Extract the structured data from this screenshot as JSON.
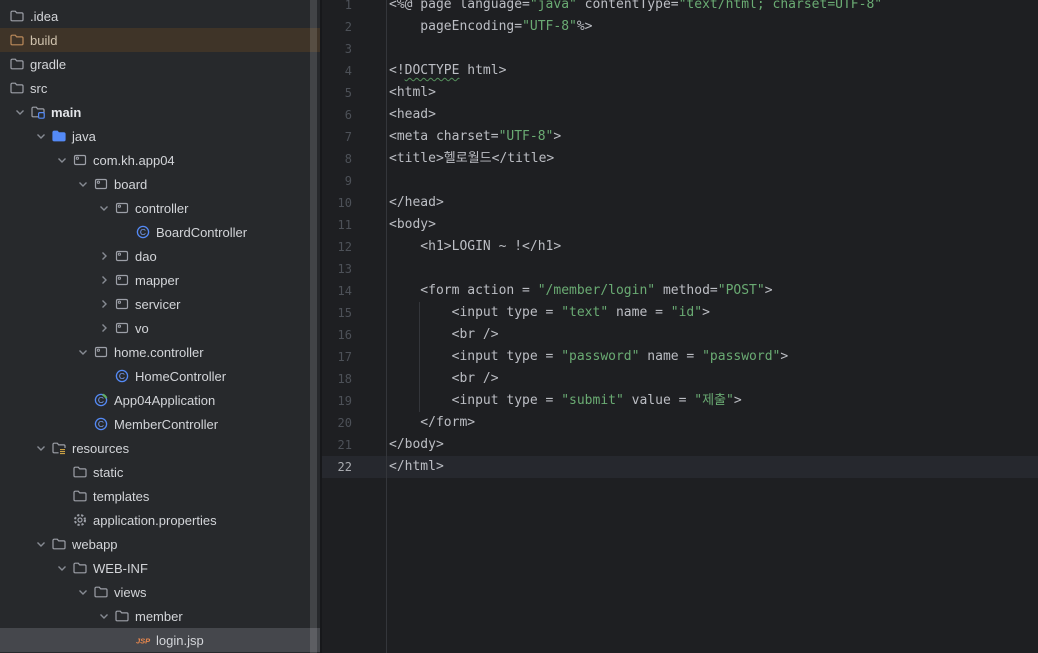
{
  "colors": {
    "editor_bg": "#1e1f22",
    "panel_bg": "#27292c",
    "code_text": "#bcbec4",
    "string_green": "#6aab73",
    "line_number_gray": "#4d5158",
    "active_line_bg": "#26282e",
    "selected_row_bg": "#45474c",
    "excluded_row_bg": "#3f3428",
    "excluded_orange": "#bb8a5a",
    "accent_blue": "#548af7",
    "run_green": "#5fad65",
    "jsp_orange": "#e8874c",
    "resources_yellow": "#caa144",
    "squiggle_green": "#56915d"
  },
  "project_tree": {
    "items": [
      {
        "label": ".idea",
        "level": 0,
        "icon": "folder",
        "chevron": null
      },
      {
        "label": "build",
        "level": 0,
        "icon": "folder-excluded",
        "chevron": null,
        "highlight": "excluded"
      },
      {
        "label": "gradle",
        "level": 0,
        "icon": "folder",
        "chevron": null
      },
      {
        "label": "src",
        "level": 0,
        "icon": "folder",
        "chevron": null
      },
      {
        "label": "main",
        "level": 1,
        "icon": "folder-main",
        "chevron": "expanded",
        "bold": true
      },
      {
        "label": "java",
        "level": 2,
        "icon": "folder-source",
        "chevron": "expanded"
      },
      {
        "label": "com.kh.app04",
        "level": 3,
        "icon": "package",
        "chevron": "expanded"
      },
      {
        "label": "board",
        "level": 4,
        "icon": "package",
        "chevron": "expanded"
      },
      {
        "label": "controller",
        "level": 5,
        "icon": "package",
        "chevron": "expanded"
      },
      {
        "label": "BoardController",
        "level": 6,
        "icon": "class",
        "chevron": null
      },
      {
        "label": "dao",
        "level": 5,
        "icon": "package",
        "chevron": "collapsed"
      },
      {
        "label": "mapper",
        "level": 5,
        "icon": "package",
        "chevron": "collapsed"
      },
      {
        "label": "servicer",
        "level": 5,
        "icon": "package",
        "chevron": "collapsed"
      },
      {
        "label": "vo",
        "level": 5,
        "icon": "package",
        "chevron": "collapsed"
      },
      {
        "label": "home.controller",
        "level": 4,
        "icon": "package",
        "chevron": "expanded"
      },
      {
        "label": "HomeController",
        "level": 5,
        "icon": "class",
        "chevron": null
      },
      {
        "label": "App04Application",
        "level": 4,
        "icon": "class-run",
        "chevron": null
      },
      {
        "label": "MemberController",
        "level": 4,
        "icon": "class",
        "chevron": null
      },
      {
        "label": "resources",
        "level": 2,
        "icon": "folder-resources",
        "chevron": "expanded"
      },
      {
        "label": "static",
        "level": 3,
        "icon": "folder",
        "chevron": null
      },
      {
        "label": "templates",
        "level": 3,
        "icon": "folder",
        "chevron": null
      },
      {
        "label": "application.properties",
        "level": 3,
        "icon": "gear",
        "chevron": null
      },
      {
        "label": "webapp",
        "level": 2,
        "icon": "folder",
        "chevron": "expanded"
      },
      {
        "label": "WEB-INF",
        "level": 3,
        "icon": "folder",
        "chevron": "expanded"
      },
      {
        "label": "views",
        "level": 4,
        "icon": "folder",
        "chevron": "expanded"
      },
      {
        "label": "member",
        "level": 5,
        "icon": "folder",
        "chevron": "expanded"
      },
      {
        "label": "login.jsp",
        "level": 6,
        "icon": "jsp",
        "chevron": null,
        "highlight": "selected"
      }
    ]
  },
  "editor": {
    "active_line": 22,
    "lines": [
      {
        "num": 1,
        "segments": [
          {
            "t": "<%@ page language=",
            "c": "p"
          },
          {
            "t": "\"java\"",
            "c": "s"
          },
          {
            "t": " contentType=",
            "c": "p"
          },
          {
            "t": "\"text/html; charset=UTF-8\"",
            "c": "s"
          }
        ]
      },
      {
        "num": 2,
        "segments": [
          {
            "t": "    pageEncoding=",
            "c": "p"
          },
          {
            "t": "\"UTF-8\"",
            "c": "s"
          },
          {
            "t": "%>",
            "c": "p"
          }
        ]
      },
      {
        "num": 3,
        "segments": []
      },
      {
        "num": 4,
        "segments": [
          {
            "t": "<!",
            "c": "p"
          },
          {
            "t": "DOCTYPE",
            "c": "p",
            "u": true
          },
          {
            "t": " html>",
            "c": "p"
          }
        ]
      },
      {
        "num": 5,
        "segments": [
          {
            "t": "<html>",
            "c": "p"
          }
        ]
      },
      {
        "num": 6,
        "segments": [
          {
            "t": "<head>",
            "c": "p"
          }
        ]
      },
      {
        "num": 7,
        "segments": [
          {
            "t": "<meta charset=",
            "c": "p"
          },
          {
            "t": "\"UTF-8\"",
            "c": "s"
          },
          {
            "t": ">",
            "c": "p"
          }
        ]
      },
      {
        "num": 8,
        "segments": [
          {
            "t": "<title>헬로월드</title>",
            "c": "p"
          }
        ]
      },
      {
        "num": 9,
        "segments": []
      },
      {
        "num": 10,
        "segments": [
          {
            "t": "</head>",
            "c": "p"
          }
        ]
      },
      {
        "num": 11,
        "segments": [
          {
            "t": "<body>",
            "c": "p"
          }
        ]
      },
      {
        "num": 12,
        "segments": [
          {
            "t": "    <h1>LOGIN ~ !</h1>",
            "c": "p"
          }
        ]
      },
      {
        "num": 13,
        "segments": []
      },
      {
        "num": 14,
        "segments": [
          {
            "t": "    <form action = ",
            "c": "p"
          },
          {
            "t": "\"/member/login\"",
            "c": "s"
          },
          {
            "t": " method=",
            "c": "p"
          },
          {
            "t": "\"POST\"",
            "c": "s"
          },
          {
            "t": ">",
            "c": "p"
          }
        ]
      },
      {
        "num": 15,
        "segments": [
          {
            "t": "        <input type = ",
            "c": "p"
          },
          {
            "t": "\"text\"",
            "c": "s"
          },
          {
            "t": " name = ",
            "c": "p"
          },
          {
            "t": "\"id\"",
            "c": "s"
          },
          {
            "t": ">",
            "c": "p"
          }
        ]
      },
      {
        "num": 16,
        "segments": [
          {
            "t": "        <br />",
            "c": "p"
          }
        ]
      },
      {
        "num": 17,
        "segments": [
          {
            "t": "        <input type = ",
            "c": "p"
          },
          {
            "t": "\"password\"",
            "c": "s"
          },
          {
            "t": " name = ",
            "c": "p"
          },
          {
            "t": "\"password\"",
            "c": "s"
          },
          {
            "t": ">",
            "c": "p"
          }
        ]
      },
      {
        "num": 18,
        "segments": [
          {
            "t": "        <br />",
            "c": "p"
          }
        ]
      },
      {
        "num": 19,
        "segments": [
          {
            "t": "        <input type = ",
            "c": "p"
          },
          {
            "t": "\"submit\"",
            "c": "s"
          },
          {
            "t": " value = ",
            "c": "p"
          },
          {
            "t": "\"제출\"",
            "c": "s"
          },
          {
            "t": ">",
            "c": "p"
          }
        ]
      },
      {
        "num": 20,
        "segments": [
          {
            "t": "    </form>",
            "c": "p"
          }
        ]
      },
      {
        "num": 21,
        "segments": [
          {
            "t": "</body>",
            "c": "p"
          }
        ]
      },
      {
        "num": 22,
        "segments": [
          {
            "t": "</html>",
            "c": "p"
          }
        ],
        "active": true
      }
    ]
  }
}
